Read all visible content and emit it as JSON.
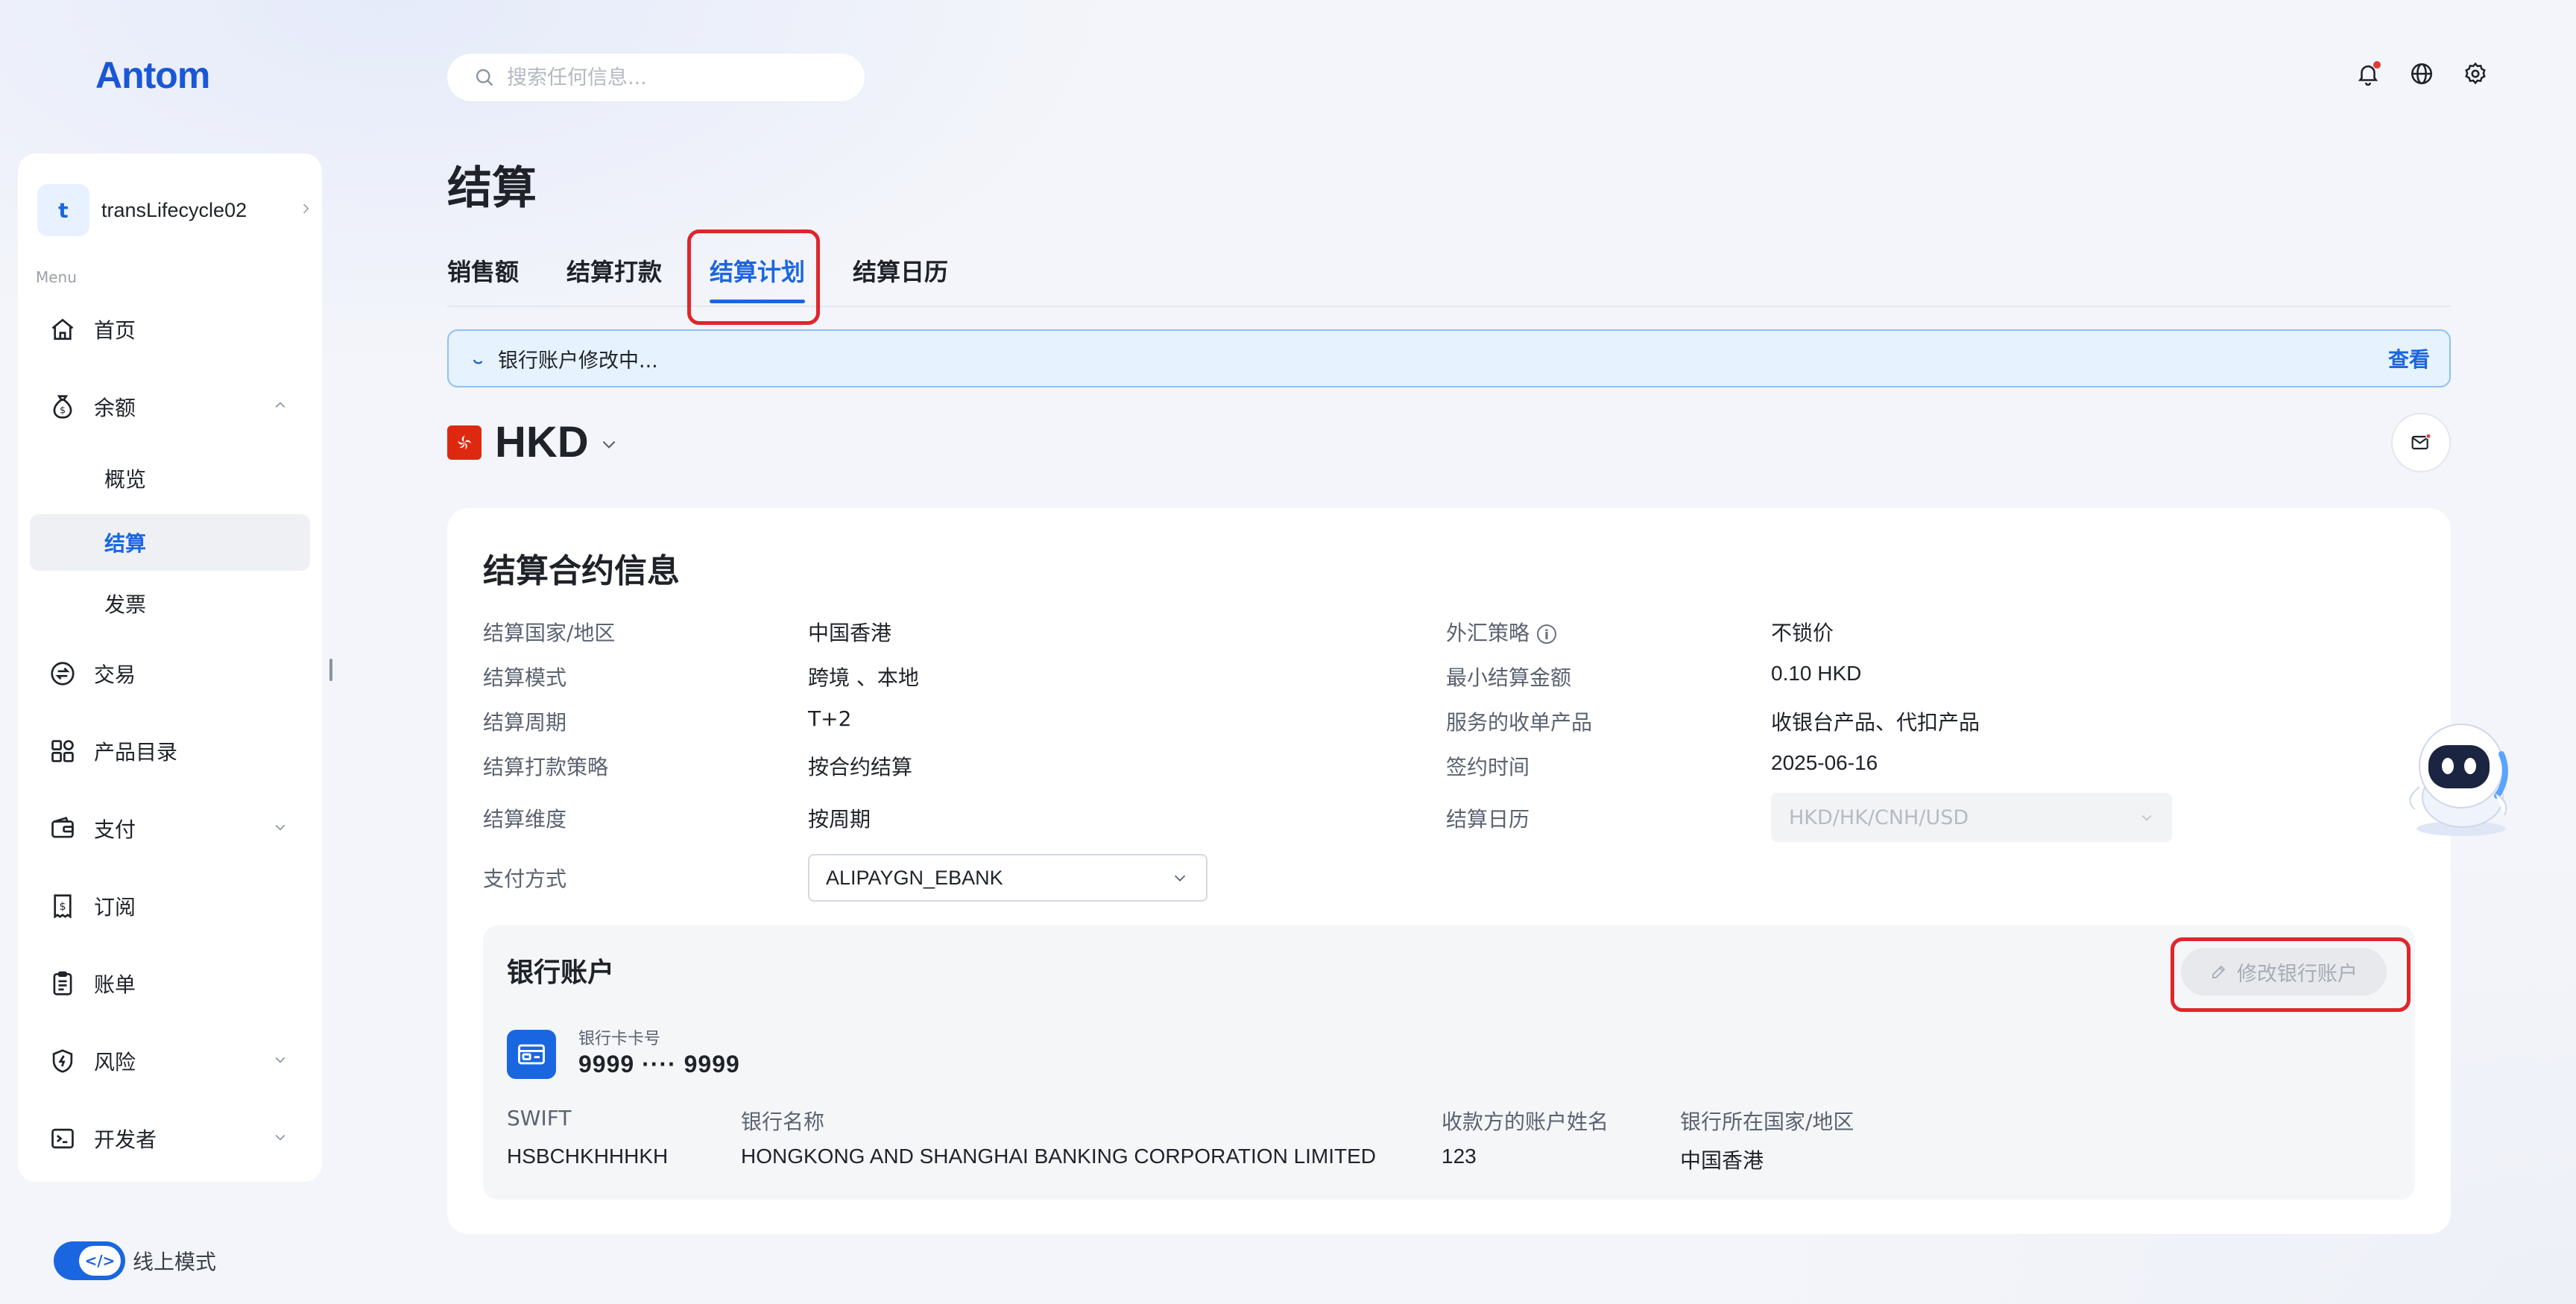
{
  "brand": {
    "logo": "Antom"
  },
  "search": {
    "placeholder": "搜索任何信息..."
  },
  "top_icons": [
    "bell-icon",
    "globe-icon",
    "settings-icon"
  ],
  "sidebar": {
    "account": {
      "initial": "t",
      "name": "transLifecycle02"
    },
    "menu_label": "Menu",
    "items": [
      {
        "label": "首页",
        "icon": "home-icon"
      },
      {
        "label": "余额",
        "icon": "money-bag-icon",
        "expanded": true
      },
      {
        "label": "概览"
      },
      {
        "label": "结算",
        "active": true
      },
      {
        "label": "发票"
      },
      {
        "label": "交易",
        "icon": "exchange-icon"
      },
      {
        "label": "产品目录",
        "icon": "grid-icon"
      },
      {
        "label": "支付",
        "icon": "wallet-icon",
        "collapsed": true
      },
      {
        "label": "订阅",
        "icon": "receipt-icon"
      },
      {
        "label": "账单",
        "icon": "clipboard-icon"
      },
      {
        "label": "风险",
        "icon": "shield-icon",
        "collapsed": true
      },
      {
        "label": "开发者",
        "icon": "terminal-icon",
        "collapsed": true
      }
    ],
    "mode_toggle": {
      "label": "线上模式",
      "on": true,
      "knob_text": "</>"
    }
  },
  "page": {
    "title": "结算",
    "tabs": [
      {
        "label": "销售额"
      },
      {
        "label": "结算打款"
      },
      {
        "label": "结算计划",
        "active": true
      },
      {
        "label": "结算日历"
      }
    ],
    "notice": {
      "text": "银行账户修改中...",
      "link": "查看"
    },
    "currency": {
      "code": "HKD",
      "flag": "hong-kong-flag"
    }
  },
  "contract": {
    "title": "结算合约信息",
    "left": [
      {
        "label": "结算国家/地区",
        "value": "中国香港"
      },
      {
        "label": "结算模式",
        "value": "跨境 、本地"
      },
      {
        "label": "结算周期",
        "value": "T+2"
      },
      {
        "label": "结算打款策略",
        "value": "按合约结算"
      },
      {
        "label": "结算维度",
        "value": "按周期"
      },
      {
        "label": "支付方式",
        "value": "ALIPAYGN_EBANK"
      }
    ],
    "right": [
      {
        "label": "外汇策略",
        "value": "不锁价"
      },
      {
        "label": "最小结算金额",
        "value": "0.10 HKD"
      },
      {
        "label": "服务的收单产品",
        "value": "收银台产品、代扣产品"
      },
      {
        "label": "签约时间",
        "value": "2025-06-16"
      },
      {
        "label": "结算日历",
        "value": "HKD/HK/CNH/USD"
      }
    ]
  },
  "bank": {
    "title": "银行账户",
    "edit_button": "修改银行账户",
    "card_label": "银行卡卡号",
    "card_number": "9999 ···· 9999",
    "fields": [
      {
        "label": "SWIFT",
        "value": "HSBCHKHHHKH"
      },
      {
        "label": "银行名称",
        "value": "HONGKONG AND SHANGHAI BANKING CORPORATION LIMITED"
      },
      {
        "label": "收款方的账户姓名",
        "value": "123"
      },
      {
        "label": "银行所在国家/地区",
        "value": "中国香港"
      }
    ]
  },
  "colors": {
    "accent": "#1a66e0",
    "highlight": "#e0262b",
    "notice_bg": "#e6f2fd"
  }
}
